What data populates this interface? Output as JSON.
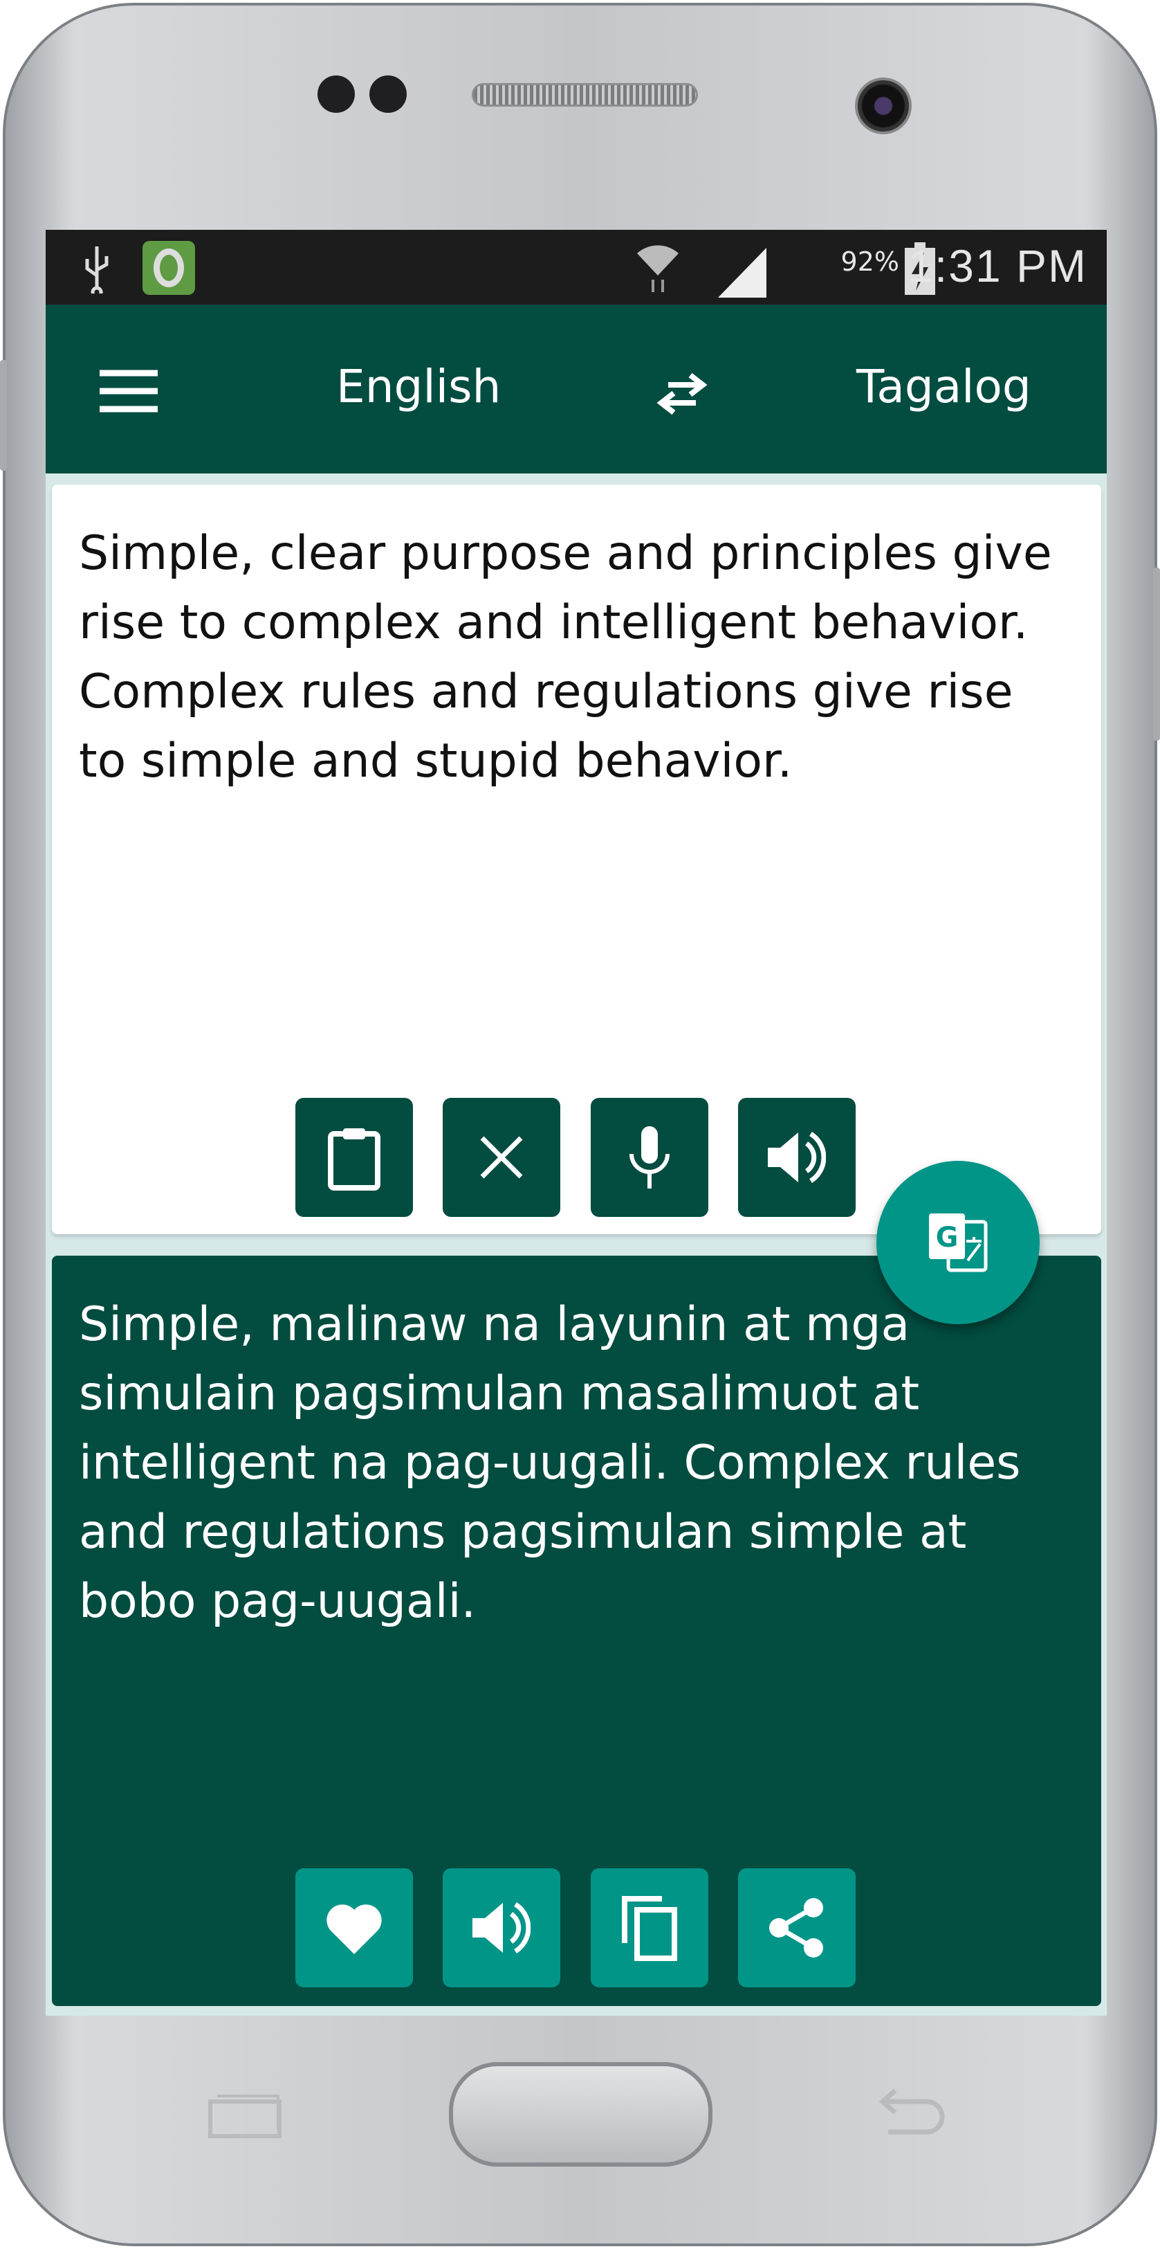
{
  "status_bar": {
    "battery": "92%",
    "time": "1:31 PM",
    "icons": [
      "usb-icon",
      "app-notification-icon",
      "wifi-icon",
      "signal-icon",
      "battery-charging-icon"
    ]
  },
  "app_bar": {
    "source_language": "English",
    "target_language": "Tagalog",
    "icons": [
      "menu-icon",
      "swap-icon"
    ]
  },
  "input": {
    "text": "Simple, clear purpose and principles give rise to complex and intelligent behavior. Complex rules and regulations give rise to simple and stupid behavior.",
    "buttons": [
      "paste-icon",
      "clear-icon",
      "microphone-icon",
      "speaker-icon"
    ]
  },
  "output": {
    "text": "Simple, malinaw na layunin at mga simulain pagsimulan masalimuot at intelligent na pag-uugali. Complex rules and regulations pagsimulan simple at bobo pag-uugali.",
    "buttons": [
      "heart-icon",
      "speaker-icon",
      "copy-icon",
      "share-icon"
    ]
  },
  "translate_fab": {
    "icon": "google-translate-icon"
  },
  "colors": {
    "primary": "#024c40",
    "accent": "#019588",
    "status_bar": "#1c1c1c"
  }
}
